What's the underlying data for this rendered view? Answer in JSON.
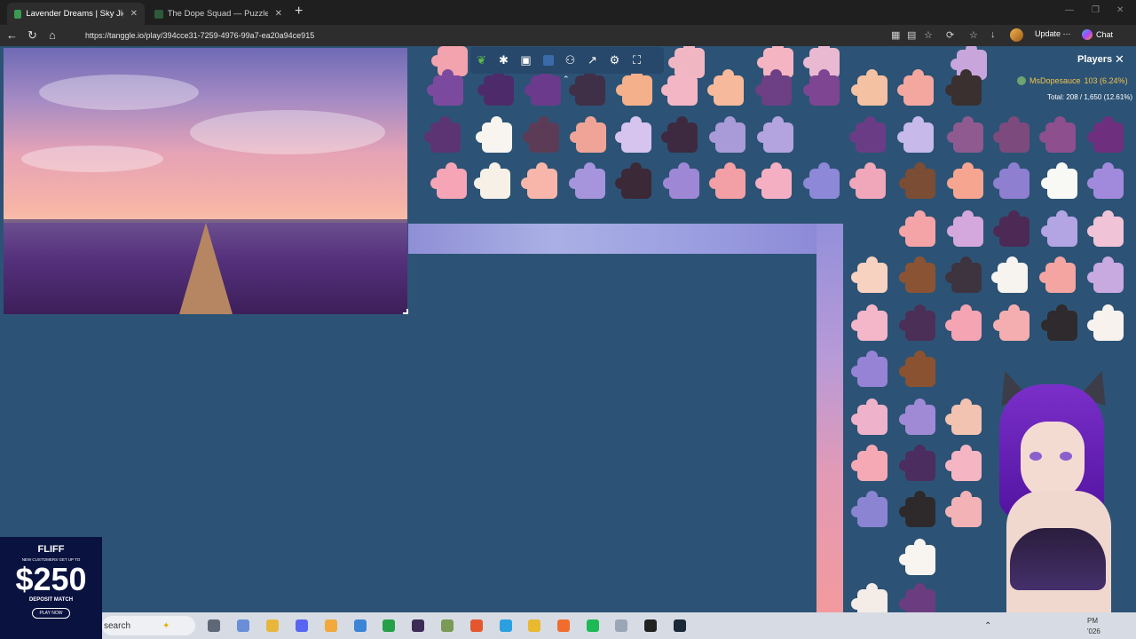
{
  "browser": {
    "tabs": [
      {
        "title": "Lavender Dreams | Sky Jigsaw"
      },
      {
        "title": "The Dope Squad — Puzzles"
      }
    ],
    "url": "https://tanggle.io/play/394cce31-7259-4976-99a7-ea20a94ce915",
    "update_label": "Update",
    "update_more": "⋯",
    "chat_label": "Chat"
  },
  "players": {
    "title": "Players",
    "player_name": "MsDopesauce",
    "player_stats": "103 (6.24%)",
    "total": "Total: 208 / 1,650 (12.61%)"
  },
  "ad": {
    "brand": "FLIFF",
    "small": "NEW CUSTOMERS GET UP TO",
    "amount": "$250",
    "deposit": "DEPOSIT MATCH",
    "play": "PLAY NOW"
  },
  "taskbar": {
    "search_label": "search",
    "tray_pm": "PM",
    "tray_year": "'026"
  },
  "colors": {
    "board_bg": "#2c5375",
    "accent_gold": "#f3c04b"
  }
}
